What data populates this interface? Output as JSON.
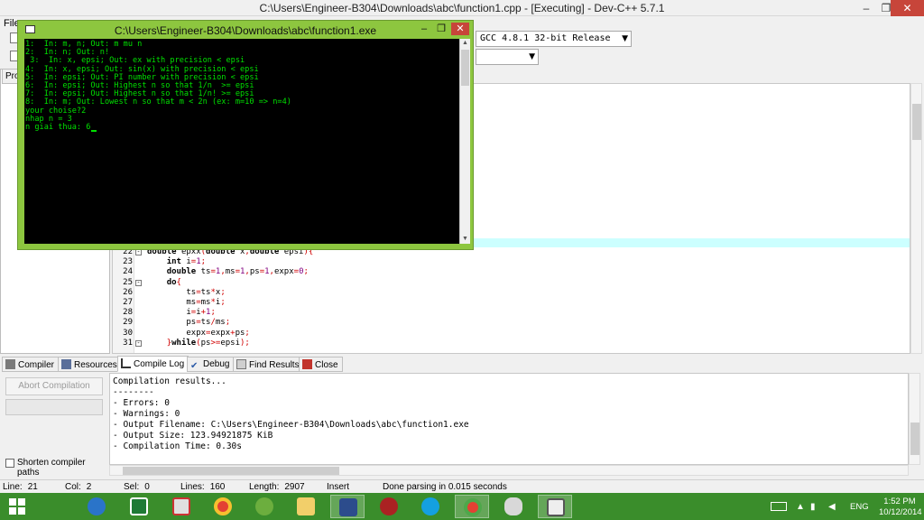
{
  "ide": {
    "title": "C:\\Users\\Engineer-B304\\Downloads\\abc\\function1.cpp - [Executing] - Dev-C++ 5.7.1",
    "window_buttons": {
      "minimize": "–",
      "maximize": "❐",
      "close": "✕"
    },
    "menu_first": "File",
    "compiler_select": "GCC 4.8.1 32-bit Release",
    "left_tab": "Proj"
  },
  "console": {
    "title": "C:\\Users\\Engineer-B304\\Downloads\\abc\\function1.exe",
    "lines": [
      "1:  In: m, n; Out: m mu n",
      "2:  In: n; Out: n!",
      " 3:  In: x, epsi; Out: ex with precision < epsi",
      "4:  In: x, epsi; Out: sin(x) with precision < epsi",
      "5:  In: epsi; Out: PI number with precision < epsi",
      "6:  In: epsi; Out: Highest n so that 1/n  >= epsi",
      "7:  In: epsi; Out: Highest n so that 1/n! >= epsi",
      "8:  In: m; Out: Lowest n so that m < 2n (ex: m=10 => n=4)",
      "your choise?2",
      "nhap n = 3",
      "n giai thua: 6"
    ]
  },
  "editor": {
    "lines": [
      {
        "num": "22",
        "fold": "⊟",
        "code": "double epxx(double x,double epsi){"
      },
      {
        "num": "23",
        "fold": "",
        "code": "    int i=1;"
      },
      {
        "num": "24",
        "fold": "",
        "code": "    double ts=1,ms=1,ps=1,expx=0;"
      },
      {
        "num": "25",
        "fold": "⊟",
        "code": "    do{"
      },
      {
        "num": "26",
        "fold": "",
        "code": "        ts=ts*x;"
      },
      {
        "num": "27",
        "fold": "",
        "code": "        ms=ms*i;"
      },
      {
        "num": "28",
        "fold": "",
        "code": "        i=i+1;"
      },
      {
        "num": "29",
        "fold": "",
        "code": "        ps=ts/ms;"
      },
      {
        "num": "30",
        "fold": "",
        "code": "        expx=expx+ps;"
      },
      {
        "num": "31",
        "fold": "⊟",
        "code": "    }while(ps>=epsi);"
      }
    ]
  },
  "bottom_tabs": [
    "Compiler",
    "Resources",
    "Compile Log",
    "Debug",
    "Find Results",
    "Close"
  ],
  "compile": {
    "abort_label": "Abort Compilation",
    "shorten_label": "Shorten compiler paths",
    "log": [
      "Compilation results...",
      "--------",
      "- Errors: 0",
      "- Warnings: 0",
      "- Output Filename: C:\\Users\\Engineer-B304\\Downloads\\abc\\function1.exe",
      "- Output Size: 123.94921875 KiB",
      "- Compilation Time: 0.30s"
    ]
  },
  "status": {
    "line_label": "Line:",
    "line": "21",
    "col_label": "Col:",
    "col": "2",
    "sel_label": "Sel:",
    "sel": "0",
    "lines_label": "Lines:",
    "lines": "160",
    "length_label": "Length:",
    "length": "2907",
    "mode": "Insert",
    "parse": "Done parsing in 0.015 seconds"
  },
  "taskbar": {
    "lang": "ENG",
    "time": "1:52 PM",
    "date": "10/12/2014"
  },
  "colors": {
    "console_frame": "#8dc63f",
    "console_text": "#00e000",
    "taskbar": "#3a8d2b",
    "highlight_line": "#ccffff"
  }
}
